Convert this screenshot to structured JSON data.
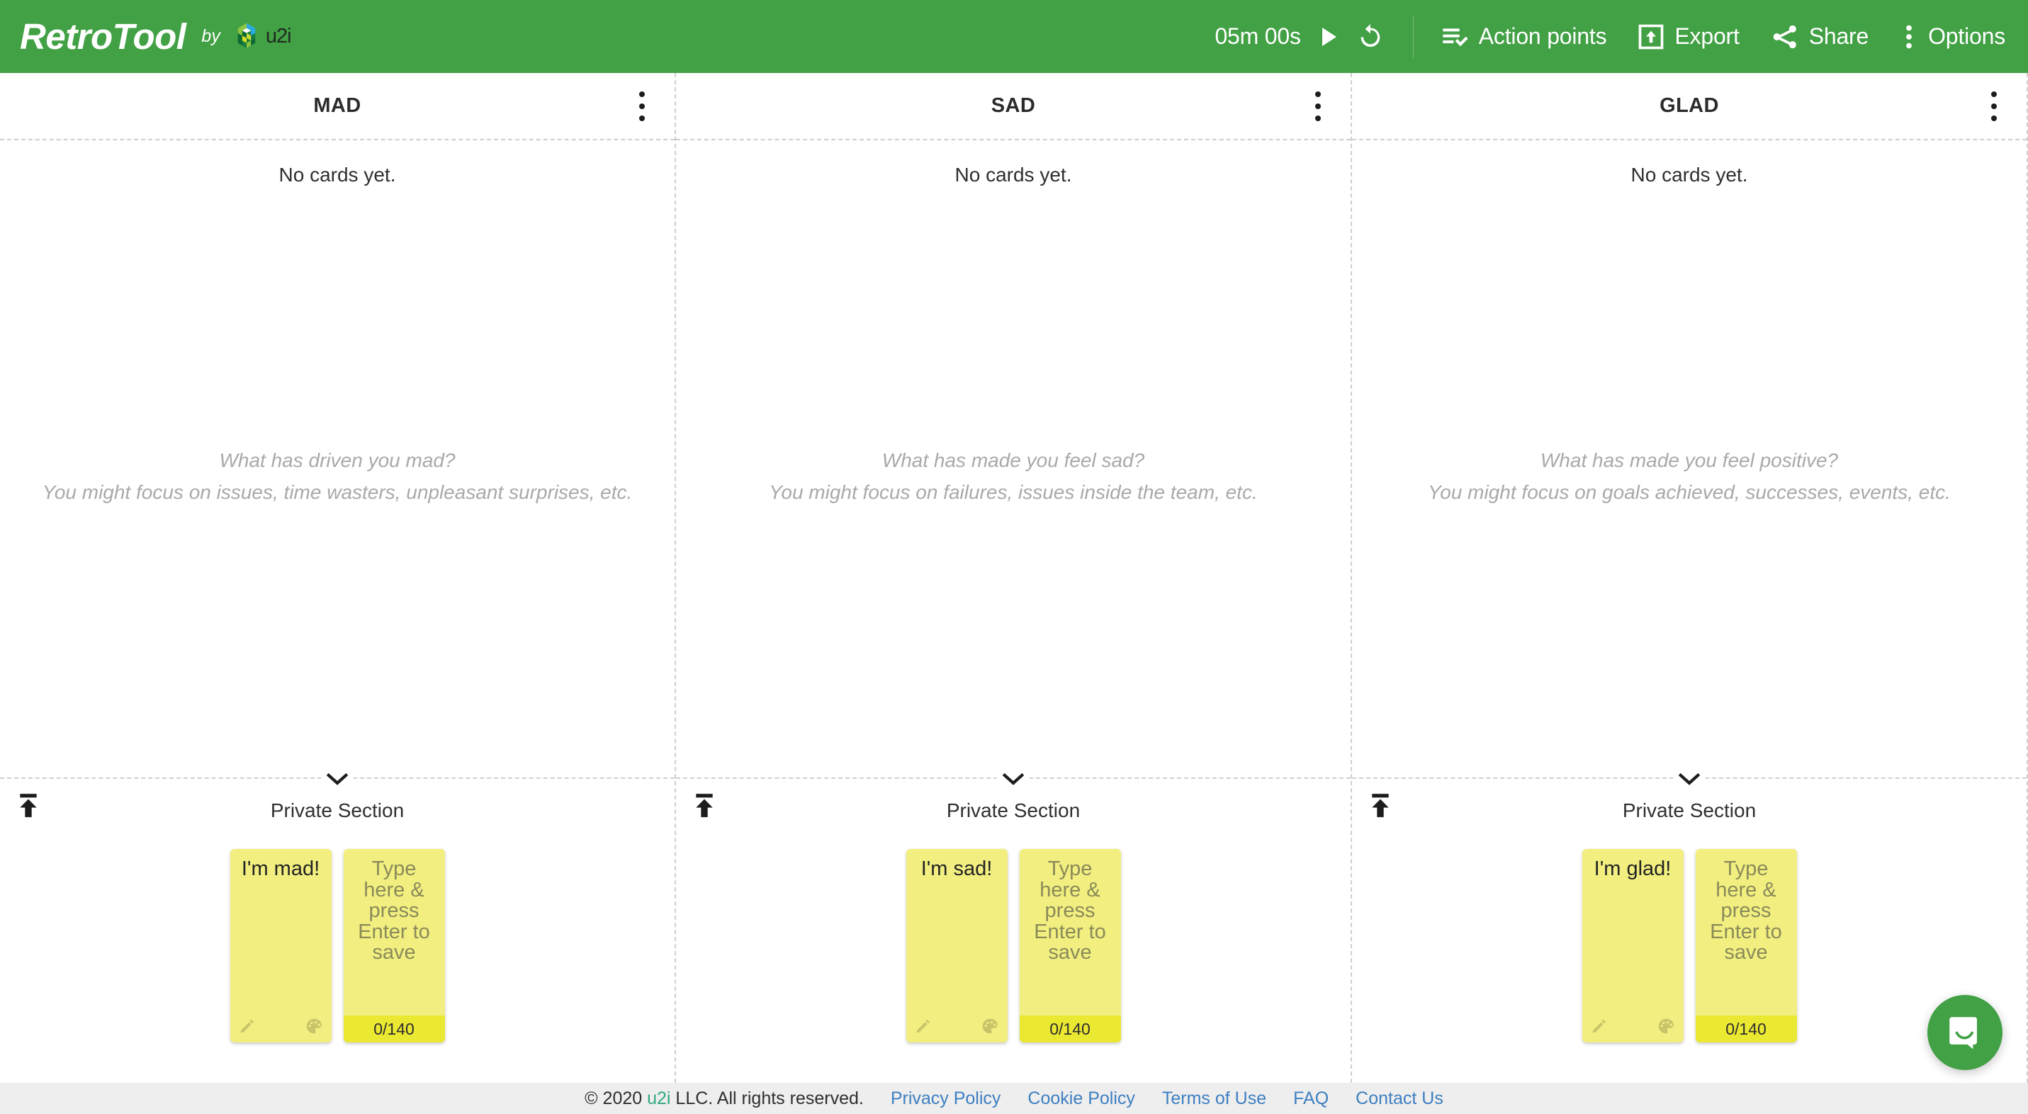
{
  "brand": {
    "name": "RetroTool",
    "by": "by",
    "company": "u2i",
    "logo_icon": "u2i-cube-logo"
  },
  "colors": {
    "header_green": "#42a045",
    "card_yellow": "#f2ef80",
    "card_counter_yellow": "#ebe832",
    "link_blue": "#3d7fc1",
    "u2i_green": "#2fa97d"
  },
  "toolbar": {
    "timer": "05m 00s",
    "play_icon": "play-icon",
    "reset_icon": "reset-timer-icon",
    "items": [
      {
        "label": "Action points",
        "icon": "action-points-icon"
      },
      {
        "label": "Export",
        "icon": "export-icon"
      },
      {
        "label": "Share",
        "icon": "share-icon"
      },
      {
        "label": "Options",
        "icon": "options-kebab-icon"
      }
    ]
  },
  "board": {
    "empty_text": "No cards yet.",
    "private_section_label": "Private Section",
    "publish_icon": "publish-to-board-icon",
    "collapse_icon": "chevron-down-icon",
    "kebab_icon": "column-menu-kebab-icon",
    "card_edit_icon": "pencil-icon",
    "card_color_icon": "palette-icon",
    "input_placeholder": "Type here & press Enter to save",
    "input_counter": "0/140",
    "columns": [
      {
        "title": "MAD",
        "hint_line1": "What has driven you mad?",
        "hint_line2": "You might focus on issues, time wasters, unpleasant surprises, etc.",
        "private_card": "I'm mad!"
      },
      {
        "title": "SAD",
        "hint_line1": "What has made you feel sad?",
        "hint_line2": "You might focus on failures, issues inside the team, etc.",
        "private_card": "I'm sad!"
      },
      {
        "title": "GLAD",
        "hint_line1": "What has made you feel positive?",
        "hint_line2": "You might focus on goals achieved, successes, events, etc.",
        "private_card": "I'm glad!"
      }
    ]
  },
  "footer": {
    "copyright_pre": "© 2020 ",
    "copyright_company": "u2i",
    "copyright_post": " LLC. All rights reserved.",
    "links": [
      "Privacy Policy",
      "Cookie Policy",
      "Terms of Use",
      "FAQ",
      "Contact Us"
    ]
  },
  "intercom": {
    "icon": "chat-bubble-smile-icon"
  }
}
